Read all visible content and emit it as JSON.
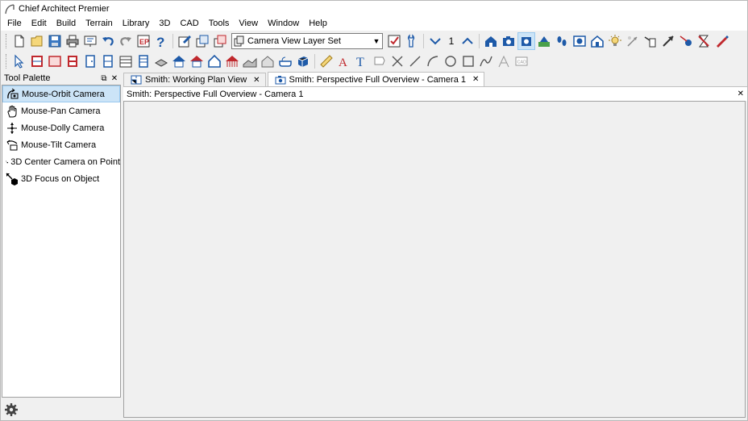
{
  "app": {
    "title": "Chief Architect Premier"
  },
  "menu": [
    "File",
    "Edit",
    "Build",
    "Terrain",
    "Library",
    "3D",
    "CAD",
    "Tools",
    "View",
    "Window",
    "Help"
  ],
  "toolbar": {
    "layer_set": "Camera View Layer Set",
    "floor_number": "1"
  },
  "palette": {
    "title": "Tool Palette",
    "items": [
      {
        "label": "Mouse-Orbit Camera",
        "icon": "orbit-camera-icon",
        "selected": true
      },
      {
        "label": "Mouse-Pan Camera",
        "icon": "pan-hand-icon",
        "selected": false
      },
      {
        "label": "Mouse-Dolly Camera",
        "icon": "dolly-arrows-icon",
        "selected": false
      },
      {
        "label": "Mouse-Tilt Camera",
        "icon": "tilt-camera-icon",
        "selected": false
      },
      {
        "label": "3D Center Camera on Point",
        "icon": "center-camera-icon",
        "selected": false
      },
      {
        "label": "3D Focus on Object",
        "icon": "focus-object-icon",
        "selected": false
      }
    ]
  },
  "tabs": [
    {
      "label": "Smith:  Working Plan View",
      "active": false
    },
    {
      "label": "Smith: Perspective Full Overview - Camera 1",
      "active": true
    }
  ],
  "view": {
    "header": "Smith: Perspective Full Overview - Camera 1"
  },
  "colors": {
    "accent": "#cce4f7",
    "icon_blue": "#1e5aa8",
    "icon_red": "#c0282d"
  }
}
